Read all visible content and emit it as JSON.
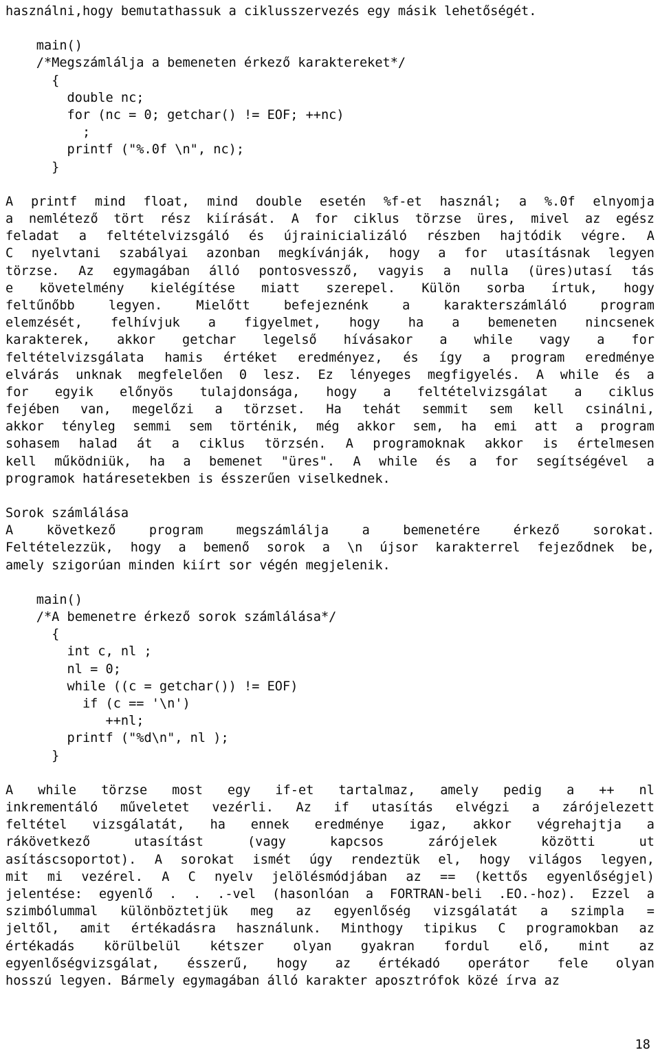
{
  "document": {
    "page_number": "18",
    "language": "hu",
    "intro_line": "használni,hogy bemutathassuk a ciklusszervezés egy másik lehetőségét.",
    "code_block_1": [
      "    main()",
      "    /*Megszámlálja a bemeneten érkező karaktereket*/",
      "      {",
      "        double nc;",
      "        for (nc = 0; getchar() != EOF; ++nc)",
      "          ;",
      "        printf (\"%.0f \\n\", nc);",
      "      }"
    ],
    "paragraph_1_lines": [
      "A  printf  mind  float,  mind  double esetén %f-et használ; a %.0f elnyomja",
      "a  nemlétező  tört  rész kiírását. A for ciklus törzse üres, mivel az egész",
      "feladat  a  feltételvizsgáló  és újrainicializáló részben hajtódik végre. A",
      "C  nyelvtani  szabályai  azonban megkívánják, hogy a for utasításnak legyen",
      "törzse.  Az  egymagában  álló  pontosvessző, vagyis a nulla (üres)utasí tás",
      "e   követelmény   kielégítése   miatt   szerepel.  Külön  sorba  írtuk,  hogy",
      "feltűnőbb  legyen.  Mielőtt  befejeznénk  a  karakterszámláló  program",
      "elemzését,  felhívjuk  a  figyelmet,  hogy  ha  a  bemeneten  nincsenek",
      "karakterek,  akkor  getchar  legelső  hívásakor  a  while  vagy  a  for",
      "feltételvizsgálata hamis értéket eredményez, és így a program eredménye",
      "elvárás  unknak  megfelelően  0 lesz. Ez lényeges megfigyelés. A while és a",
      "for   egyik   előnyös  tulajdonsága,  hogy  a  feltételvizsgálat  a  ciklus",
      "fejében  van,  megelőzi  a  törzset.  Ha  tehát  semmit  sem kell csinálni,",
      "akkor  tényleg  semmi  sem  történik,  még  akkor sem, ha emi att a program",
      "sohasem  halad  át  a  ciklus  törzsén.  A programoknak akkor is értelmesen",
      "kell  működniük,  ha  a  bemenet \"üres\".  A  while és a for segítségével a",
      "programok határesetekben is ésszerűen viselkednek."
    ],
    "section_heading": "Sorok számlálása",
    "paragraph_2_lines": [
      "A   következő   program   megszámlálja   a   bemenetére   érkező   sorokat.",
      "Feltételezzük,  hogy  a  bemenő sorok a \\n újsor karakterrel fejeződnek be,",
      "amely szigorúan minden kiírt sor végén megjelenik."
    ],
    "code_block_2": [
      "    main()",
      "    /*A bemenetre érkező sorok számlálása*/",
      "      {",
      "        int c, nl ;",
      "        nl = 0;",
      "        while ((c = getchar()) != EOF)",
      "          if (c == '\\n')",
      "             ++nl;",
      "        printf (\"%d\\n\", nl );",
      "      }"
    ],
    "paragraph_3_lines": [
      "A  while  törzse  most  egy if-et tartalmaz, amely pedig a ++ nl",
      "inkrementáló  műveletet  vezérli.  Az  if  utasítás  elvégzi a zárójelezett",
      "feltétel  vizsgálatát,  ha  ennek  eredménye  igaz,  akkor  végrehajtja a",
      "rákövetkező    utasítást    (vagy    kapcsos    zárójelek    közötti    ut",
      "asításcsoportot).  A  sorokat  ismét úgy rendeztük el, hogy világos legyen,",
      "mit  mi  vezérel.  A  C  nyelv jelölésmódjában az == (kettős egyenlőségjel)",
      "jelentése: egyenlő  . . .-vel (hasonlóan a FORTRAN-beli .EO.-hoz). Ezzel a",
      "szimbólummal  különböztetjük  meg  az  egyenlőség  vizsgálatát  a szimpla =",
      "jeltől,  amit  értékadásra  használunk.  Minthogy tipikus C programokban az",
      "értékadás   körülbelül   kétszer   olyan   gyakran   fordul  elő,  mint  az",
      "egyenlőségvizsgálat,  ésszerű,  hogy  az  értékadó  operátor  fele  olyan",
      "hosszú  legyen.  Bármely  egymagában álló karakter aposztrófok közé írva az"
    ]
  }
}
